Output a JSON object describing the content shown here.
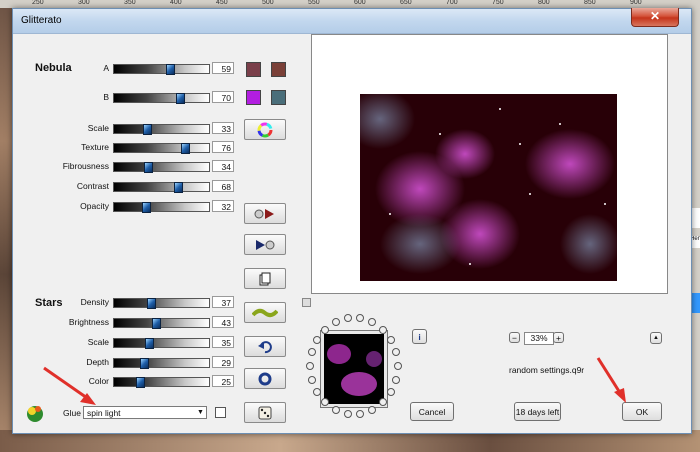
{
  "host": {
    "ruler_marks": [
      "250",
      "300",
      "350",
      "400",
      "450",
      "500",
      "550",
      "600",
      "650",
      "700",
      "750",
      "800",
      "850",
      "900"
    ],
    "right_panel_text": "Hen"
  },
  "dialog": {
    "title": "Glitterato",
    "close_glyph": "✕"
  },
  "nebula": {
    "title": "Nebula",
    "params": [
      {
        "label": "A",
        "value": "59",
        "pos": 0.59
      },
      {
        "label": "B",
        "value": "70",
        "pos": 0.7
      },
      {
        "label": "Scale",
        "value": "33",
        "pos": 0.33
      },
      {
        "label": "Texture",
        "value": "76",
        "pos": 0.76
      },
      {
        "label": "Fibrousness",
        "value": "34",
        "pos": 0.34
      },
      {
        "label": "Contrast",
        "value": "68",
        "pos": 0.68
      },
      {
        "label": "Opacity",
        "value": "32",
        "pos": 0.32
      }
    ],
    "swatch_colors": [
      "#7a3f4a",
      "#7a4038",
      "#b21ee0",
      "#4a6e7a"
    ]
  },
  "stars": {
    "title": "Stars",
    "params": [
      {
        "label": "Density",
        "value": "37",
        "pos": 0.37
      },
      {
        "label": "Brightness",
        "value": "43",
        "pos": 0.43
      },
      {
        "label": "Scale",
        "value": "35",
        "pos": 0.35
      },
      {
        "label": "Depth",
        "value": "29",
        "pos": 0.29
      },
      {
        "label": "Color",
        "value": "25",
        "pos": 0.25
      }
    ]
  },
  "glue": {
    "label": "Glue",
    "selected": "spin light"
  },
  "preview": {
    "zoom": "33%",
    "zoom_minus": "−",
    "zoom_plus": "+",
    "filename": "random settings.q9r",
    "info": "i",
    "collapse": "▲"
  },
  "buttons": {
    "cancel": "Cancel",
    "trial": "18 days left",
    "ok": "OK"
  },
  "icons": {
    "color-wheel": "color-wheel-icon",
    "undo": "undo-icon",
    "reset": "reset-icon",
    "dice": "dice-icon"
  },
  "accent_colors": {
    "arrow": "#e0302a",
    "nebula_bg": "#280007",
    "nebula_glow": "#c040c0"
  }
}
